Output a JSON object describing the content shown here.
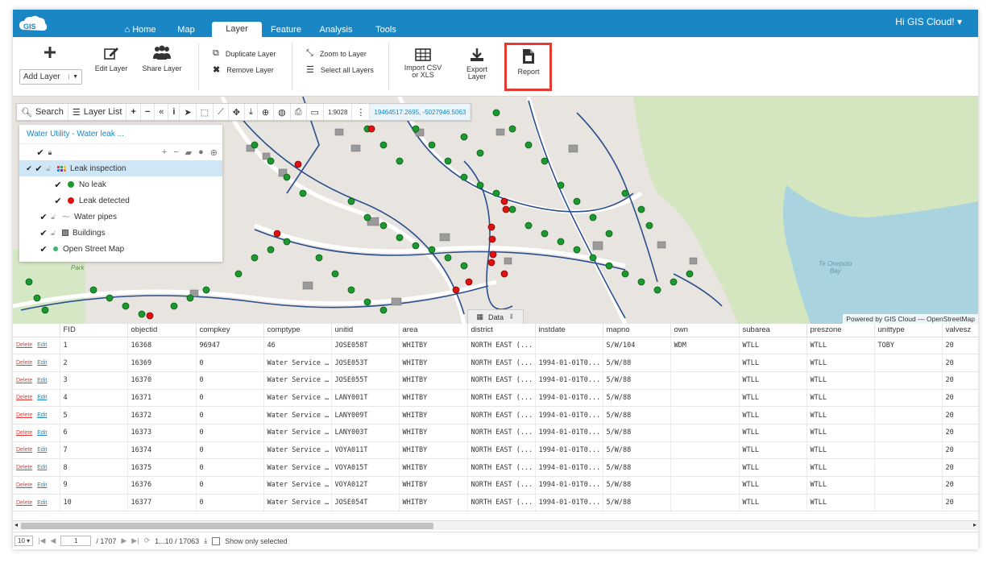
{
  "app": {
    "logo_text": "GIS",
    "greeting": "Hi GIS Cloud! ▾"
  },
  "nav": {
    "tabs": [
      "Home",
      "Map",
      "Layer",
      "Feature",
      "Analysis",
      "Tools"
    ],
    "active": "Layer"
  },
  "ribbon": {
    "add_layer": "Add Layer",
    "edit_layer": "Edit Layer",
    "share_layer": "Share Layer",
    "duplicate_layer": "Duplicate Layer",
    "remove_layer": "Remove Layer",
    "zoom_to_layer": "Zoom to Layer",
    "select_all_layers": "Select all Layers",
    "import_csv_line1": "Import CSV",
    "import_csv_line2": "or XLS",
    "export_layer_line1": "Export",
    "export_layer_line2": "Layer",
    "report": "Report"
  },
  "map_toolbar": {
    "search": "Search",
    "layer_list": "Layer List",
    "scale": "1:9028",
    "coordinates": "19464517.2695, -5027946.5063"
  },
  "layer_panel": {
    "title": "Water Utility - Water leak ...",
    "items": [
      {
        "label": "Leak inspection",
        "color": "#f0a030"
      },
      {
        "label": "No leak",
        "color": "#1a9a2e"
      },
      {
        "label": "Leak detected",
        "color": "#e01010"
      },
      {
        "label": "Water pipes",
        "color": "#777777"
      },
      {
        "label": "Buildings",
        "color": "#888888"
      },
      {
        "label": "Open Street Map",
        "color": "#3ab56c"
      }
    ]
  },
  "map": {
    "attribution": "Powered by GIS Cloud — OpenStreetMap",
    "data_tab": "Data",
    "place_label_1": "Te Onepoto",
    "place_label_2": "Bay",
    "park_label": "Park"
  },
  "table": {
    "delete_label": "Delete",
    "edit_label": "Edit",
    "columns": [
      "FID",
      "objectid",
      "compkey",
      "comptype",
      "unitid",
      "area",
      "district",
      "instdate",
      "mapno",
      "own",
      "subarea",
      "preszone",
      "unittype",
      "valvesz"
    ],
    "rows": [
      [
        "1",
        "16368",
        "96947",
        "46",
        "JOSE058T",
        "WHITBY",
        "NORTH EAST (...",
        "",
        "S/W/104",
        "WDM",
        "WTLL",
        "WTLL",
        "TOBY",
        "20"
      ],
      [
        "2",
        "16369",
        "0",
        "Water Service ...",
        "JOSE053T",
        "WHITBY",
        "NORTH EAST (...",
        "1994-01-01T0...",
        "5/W/88",
        "",
        "WTLL",
        "WTLL",
        "",
        "20"
      ],
      [
        "3",
        "16370",
        "0",
        "Water Service ...",
        "JOSE055T",
        "WHITBY",
        "NORTH EAST (...",
        "1994-01-01T0...",
        "5/W/88",
        "",
        "WTLL",
        "WTLL",
        "",
        "20"
      ],
      [
        "4",
        "16371",
        "0",
        "Water Service ...",
        "LANY001T",
        "WHITBY",
        "NORTH EAST (...",
        "1994-01-01T0...",
        "5/W/88",
        "",
        "WTLL",
        "WTLL",
        "",
        "20"
      ],
      [
        "5",
        "16372",
        "0",
        "Water Service ...",
        "LANY009T",
        "WHITBY",
        "NORTH EAST (...",
        "1994-01-01T0...",
        "5/W/88",
        "",
        "WTLL",
        "WTLL",
        "",
        "20"
      ],
      [
        "6",
        "16373",
        "0",
        "Water Service ...",
        "LANY003T",
        "WHITBY",
        "NORTH EAST (...",
        "1994-01-01T0...",
        "5/W/88",
        "",
        "WTLL",
        "WTLL",
        "",
        "20"
      ],
      [
        "7",
        "16374",
        "0",
        "Water Service ...",
        "VOYA011T",
        "WHITBY",
        "NORTH EAST (...",
        "1994-01-01T0...",
        "5/W/88",
        "",
        "WTLL",
        "WTLL",
        "",
        "20"
      ],
      [
        "8",
        "16375",
        "0",
        "Water Service ...",
        "VOYA015T",
        "WHITBY",
        "NORTH EAST (...",
        "1994-01-01T0...",
        "5/W/88",
        "",
        "WTLL",
        "WTLL",
        "",
        "20"
      ],
      [
        "9",
        "16376",
        "0",
        "Water Service ...",
        "VOYA012T",
        "WHITBY",
        "NORTH EAST (...",
        "1994-01-01T0...",
        "5/W/88",
        "",
        "WTLL",
        "WTLL",
        "",
        "20"
      ],
      [
        "10",
        "16377",
        "0",
        "Water Service ...",
        "JOSE054T",
        "WHITBY",
        "NORTH EAST (...",
        "1994-01-01T0...",
        "5/W/88",
        "",
        "WTLL",
        "WTLL",
        "",
        "20"
      ]
    ]
  },
  "pager": {
    "page_size": "10",
    "page": "1",
    "total_pages": "/ 1707",
    "range": "1...10 / 17063",
    "show_selected": "Show only selected"
  }
}
